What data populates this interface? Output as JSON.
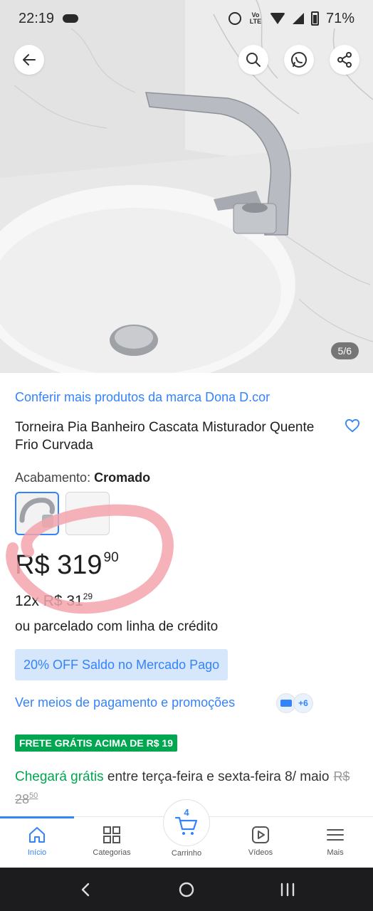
{
  "status_bar": {
    "time": "22:19",
    "volte": "Vo LTE",
    "battery": "71%"
  },
  "hero": {
    "image_counter": "5/6",
    "buttons": [
      "back-icon",
      "search-icon",
      "whatsapp-icon",
      "share-icon"
    ]
  },
  "product": {
    "brand_link": "Conferir mais produtos da marca Dona D.cor",
    "title": "Torneira Pia Banheiro Cascata Misturador Quente Frio Curvada",
    "variant_label": "Acabamento:",
    "variant_value": "Cromado",
    "price_main": "R$ 319",
    "price_cents": "90",
    "installments_prefix": "12x R$ 31",
    "installments_cents": "29",
    "credit_text": "ou parcelado com linha de crédito",
    "promo": "20% OFF Saldo no Mercado Pago",
    "payment_link": "Ver meios de pagamento e promoções",
    "payment_more": "+6",
    "shipping_badge": "FRETE GRÁTIS ACIMA DE R$ 19",
    "delivery_highlight": "Chegará grátis",
    "delivery_text": " entre terça-feira e sexta-feira 8/ maio",
    "old_shipping_price": "R$ 28",
    "old_shipping_cents": "50"
  },
  "tabbar": {
    "items": [
      {
        "label": "Início",
        "icon": "home-icon"
      },
      {
        "label": "Categorias",
        "icon": "grid-icon"
      },
      {
        "label": "Carrinho",
        "icon": "cart-icon"
      },
      {
        "label": "Vídeos",
        "icon": "video-icon"
      },
      {
        "label": "Mais",
        "icon": "menu-icon"
      }
    ],
    "cart_count": "4"
  },
  "colors": {
    "accent": "#3483fa",
    "green": "#00a650",
    "promo_bg": "#d6e7fb",
    "annotation": "#f3a5ad"
  }
}
